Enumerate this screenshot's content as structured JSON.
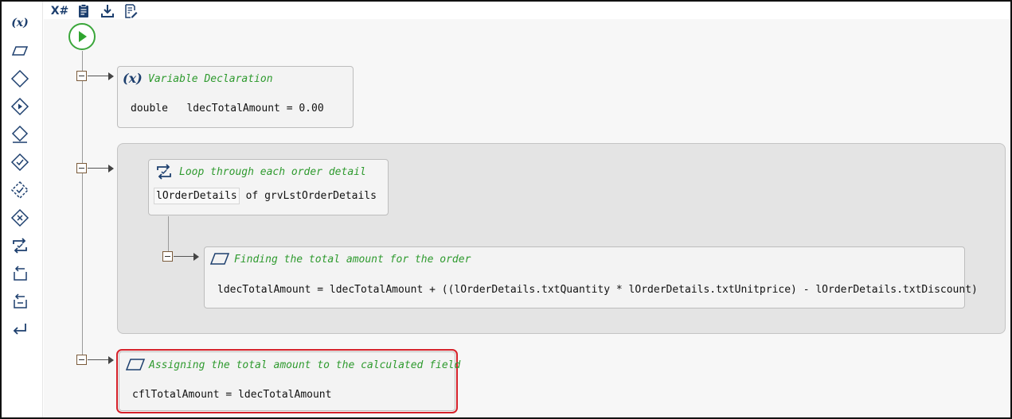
{
  "colors": {
    "accent_green": "#2e9a2e",
    "icon_navy": "#1d3f6e",
    "selection_red": "#d6212a",
    "canvas_bg": "#f7f7f7",
    "loop_bg": "#e4e4e4"
  },
  "sidebar": {
    "items": [
      {
        "icon": "variable-x-icon",
        "label": "(x)"
      },
      {
        "icon": "parallelogram-icon"
      },
      {
        "icon": "diamond-icon"
      },
      {
        "icon": "diamond-play-icon"
      },
      {
        "icon": "diamond-eraser-icon"
      },
      {
        "icon": "diamond-check-icon"
      },
      {
        "icon": "diamond-dashed-check-icon"
      },
      {
        "icon": "diamond-x-icon"
      },
      {
        "icon": "loop-icon"
      },
      {
        "icon": "return-box-icon"
      },
      {
        "icon": "return-list-icon"
      },
      {
        "icon": "enter-return-icon"
      }
    ]
  },
  "toolbar": {
    "xhash_label": "X#",
    "items": [
      "x-hash-icon",
      "clipboard-icon",
      "download-icon",
      "document-edit-icon"
    ]
  },
  "flow": {
    "start_icon": "play-icon",
    "variable_declaration": {
      "icon_label": "(x)",
      "title": "Variable Declaration",
      "type": "double",
      "name": "ldecTotalAmount",
      "operator": "=",
      "value": "0.00"
    },
    "loop": {
      "title": "Loop through each order detail",
      "item_var": "lOrderDetails",
      "of_text": "of",
      "collection": "grvLstOrderDetails",
      "inner_step": {
        "title": "Finding the total amount for the order",
        "expression": "ldecTotalAmount = ldecTotalAmount + ((lOrderDetails.txtQuantity * lOrderDetails.txtUnitprice) - lOrderDetails.txtDiscount)"
      }
    },
    "assign_step": {
      "title": "Assigning the total amount to the calculated field",
      "expression": "cflTotalAmount = ldecTotalAmount",
      "selected": true
    }
  }
}
